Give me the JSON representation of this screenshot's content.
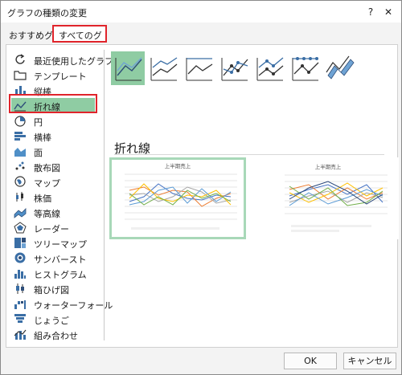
{
  "window": {
    "title": "グラフの種類の変更",
    "help_label": "?",
    "close_label": "✕"
  },
  "tabs": [
    {
      "label": "おすすめグラフ"
    },
    {
      "label": "すべてのグラフ"
    }
  ],
  "sidebar": {
    "items": [
      {
        "label": "最近使用したグラフ",
        "icon": "recent-icon"
      },
      {
        "label": "テンプレート",
        "icon": "folder-icon"
      },
      {
        "label": "縦棒",
        "icon": "column-chart-icon"
      },
      {
        "label": "折れ線",
        "icon": "line-chart-icon"
      },
      {
        "label": "円",
        "icon": "pie-chart-icon"
      },
      {
        "label": "横棒",
        "icon": "bar-chart-icon"
      },
      {
        "label": "面",
        "icon": "area-chart-icon"
      },
      {
        "label": "散布図",
        "icon": "scatter-chart-icon"
      },
      {
        "label": "マップ",
        "icon": "map-chart-icon"
      },
      {
        "label": "株価",
        "icon": "stock-chart-icon"
      },
      {
        "label": "等高線",
        "icon": "surface-chart-icon"
      },
      {
        "label": "レーダー",
        "icon": "radar-chart-icon"
      },
      {
        "label": "ツリーマップ",
        "icon": "treemap-chart-icon"
      },
      {
        "label": "サンバースト",
        "icon": "sunburst-chart-icon"
      },
      {
        "label": "ヒストグラム",
        "icon": "histogram-chart-icon"
      },
      {
        "label": "箱ひげ図",
        "icon": "boxwhisker-chart-icon"
      },
      {
        "label": "ウォーターフォール",
        "icon": "waterfall-chart-icon"
      },
      {
        "label": "じょうご",
        "icon": "funnel-chart-icon"
      },
      {
        "label": "組み合わせ",
        "icon": "combo-chart-icon"
      }
    ],
    "selected_index": 3
  },
  "main": {
    "section_title": "折れ線",
    "subtypes": [
      "line",
      "stacked-line",
      "100-stacked-line",
      "line-markers",
      "stacked-line-markers",
      "100-stacked-line-markers",
      "3d-line"
    ],
    "selected_subtype_index": 0,
    "previews": [
      {
        "title": "上半期売上",
        "selected": true
      },
      {
        "title": "上半期売上",
        "selected": false
      }
    ]
  },
  "colors": {
    "accent": "#217346",
    "selection": "#8fcca3",
    "highlight_box": "#e0242b"
  },
  "footer": {
    "ok_label": "OK",
    "cancel_label": "キャンセル"
  }
}
